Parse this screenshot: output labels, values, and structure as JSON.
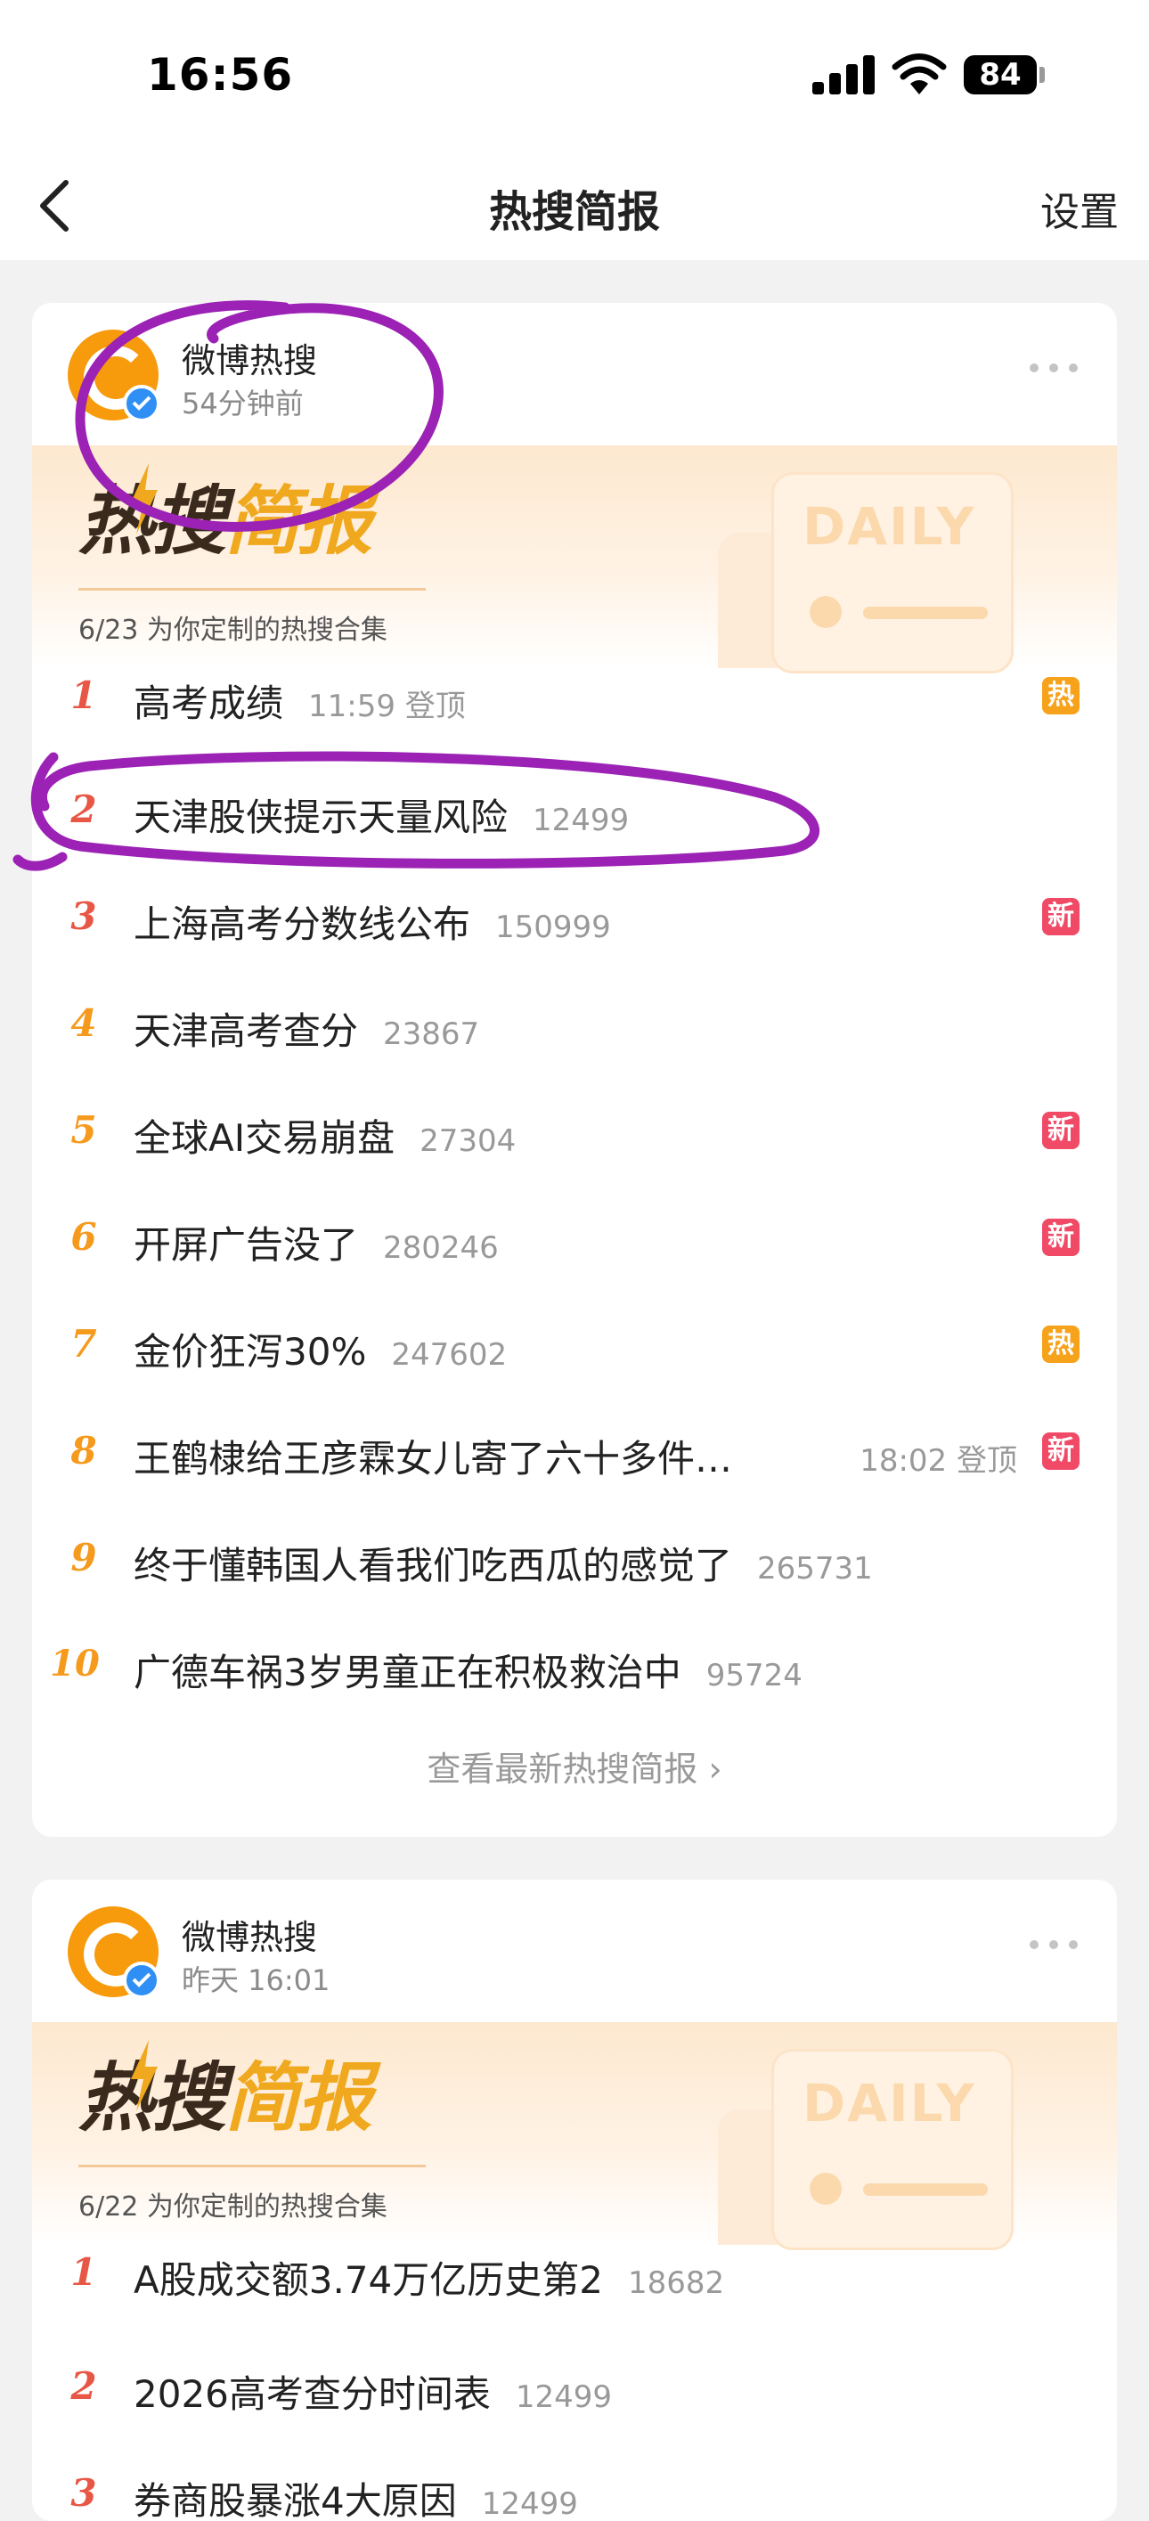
{
  "status_bar": {
    "time": "16:56",
    "battery": "84"
  },
  "nav": {
    "title": "热搜简报",
    "settings_label": "设置"
  },
  "colors": {
    "marker": "#9b22b5",
    "accent": "#f79a0c",
    "rank_top": "#e85745",
    "rank_mid": "#f59a1c",
    "badge_hot": "#f7a21b",
    "badge_new": "#f04a67"
  },
  "cards": [
    {
      "author": "微博热搜",
      "time": "54分钟前",
      "banner": {
        "logo_part1": "热搜",
        "logo_part2": "简报",
        "date_text": "6/23 为你定制的热搜合集",
        "daily": "DAILY"
      },
      "items": [
        {
          "rank": "1",
          "title": "高考成绩",
          "meta": "11:59 登顶",
          "badge": "热"
        },
        {
          "rank": "2",
          "title": "天津股侠提示天量风险",
          "meta": "12499"
        },
        {
          "rank": "3",
          "title": "上海高考分数线公布",
          "meta": "150999",
          "badge": "新"
        },
        {
          "rank": "4",
          "title": "天津高考查分",
          "meta": "23867"
        },
        {
          "rank": "5",
          "title": "全球AI交易崩盘",
          "meta": "27304",
          "badge": "新"
        },
        {
          "rank": "6",
          "title": "开屏广告没了",
          "meta": "280246",
          "badge": "新"
        },
        {
          "rank": "7",
          "title": "金价狂泻30%",
          "meta": "247602",
          "badge": "热"
        },
        {
          "rank": "8",
          "title": "王鹤棣给王彦霖女儿寄了六十多件…",
          "meta": "18:02 登顶",
          "badge": "新"
        },
        {
          "rank": "9",
          "title": "终于懂韩国人看我们吃西瓜的感觉了",
          "meta": "265731"
        },
        {
          "rank": "10",
          "title": "广德车祸3岁男童正在积极救治中",
          "meta": "95724"
        }
      ],
      "view_latest": "查看最新热搜简报 ›"
    },
    {
      "author": "微博热搜",
      "time": "昨天 16:01",
      "banner": {
        "logo_part1": "热搜",
        "logo_part2": "简报",
        "date_text": "6/22 为你定制的热搜合集",
        "daily": "DAILY"
      },
      "items": [
        {
          "rank": "1",
          "title": "A股成交额3.74万亿历史第2",
          "meta": "18682"
        },
        {
          "rank": "2",
          "title": "2026高考查分时间表",
          "meta": "12499"
        },
        {
          "rank": "3",
          "title": "券商股暴涨4大原因",
          "meta": "12499"
        }
      ]
    }
  ]
}
